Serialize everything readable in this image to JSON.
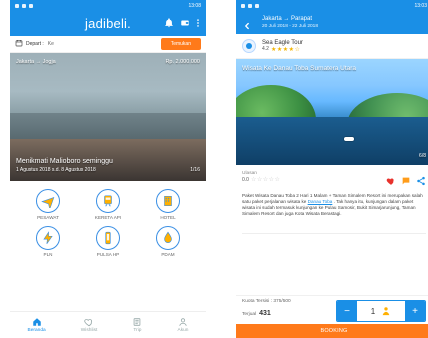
{
  "left": {
    "status": {
      "time": "13:08"
    },
    "app": {
      "brand": "jadibeli."
    },
    "search": {
      "date_label": "Depart :",
      "middle_hint": "Ke",
      "button_label": "Temukan"
    },
    "hero": {
      "route": "Jakarta → Jogja",
      "price": "Rp. 2.000.000",
      "title": "Menikmati Malioboro seminggu",
      "subtitle": "1 Agustus 2018 s.d. 8 Agustus 2018",
      "page": "1/16"
    },
    "services": [
      {
        "label": "PESAWAT",
        "icon": "plane-icon"
      },
      {
        "label": "KERETA API",
        "icon": "train-icon"
      },
      {
        "label": "HOTEL",
        "icon": "hotel-icon"
      },
      {
        "label": "PLN",
        "icon": "electricity-icon"
      },
      {
        "label": "PULSA HP",
        "icon": "phone-icon"
      },
      {
        "label": "PDAM",
        "icon": "water-drop-icon"
      }
    ],
    "bottom_nav": [
      {
        "label": "Beranda",
        "icon": "home-icon",
        "active": true
      },
      {
        "label": "Wishlist",
        "icon": "heart-icon",
        "active": false
      },
      {
        "label": "Trip",
        "icon": "list-icon",
        "active": false
      },
      {
        "label": "Akun",
        "icon": "user-icon",
        "active": false
      }
    ]
  },
  "right": {
    "status": {
      "time": "13:03"
    },
    "header": {
      "title": "Jakarta → Parapat",
      "subtitle": "20 Juli 2018 - 22 Juli 2018"
    },
    "vendor": {
      "name": "Sea Eagle Tour",
      "rating": "4.2",
      "stars": "★★★★☆"
    },
    "photo": {
      "title": "Wisata Ke Danau Toba Sumatera Utara",
      "page": "6/8"
    },
    "rating": {
      "label": "Ulasan",
      "score": "0.0",
      "stars": "☆☆☆☆☆"
    },
    "description": {
      "p1": "Paket Wisata Danau Toba 2 Hari 1 Malam + Taman Simalem Resort ini merupakan salah satu paket perjalanan wisata ke",
      "link": "Danau Toba",
      "p2": ". Tak hanya itu, kunjungan dalam paket wisata ini sudah termasuk kunjungan ke Pulau Samosir, Bukit Simarjarunjung, Taman Simalem Resort dan juga Kota Wisata Berastagi."
    },
    "bottom": {
      "kuota": "Kuota Tersisi : 375/500",
      "terjual_label": "Terjual",
      "terjual_value": "431",
      "qty_value": "1"
    },
    "cta": {
      "label": "BOOKING"
    }
  }
}
